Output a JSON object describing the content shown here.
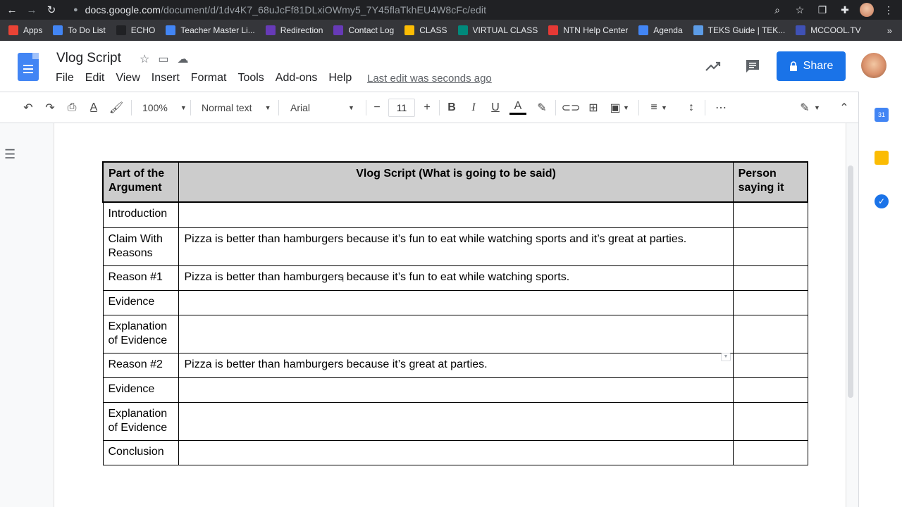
{
  "browser": {
    "url_host": "docs.google.com",
    "url_path": "/document/d/1dv4K7_68uJcFf81DLxiOWmy5_7Y45flaTkhEU4W8cFc/edit"
  },
  "bookmarks": [
    {
      "label": "Apps",
      "color": "#ea4335"
    },
    {
      "label": "To Do List",
      "color": "#4285f4"
    },
    {
      "label": "ECHO",
      "color": "#202124"
    },
    {
      "label": "Teacher Master Li...",
      "color": "#4285f4"
    },
    {
      "label": "Redirection",
      "color": "#673ab7"
    },
    {
      "label": "Contact Log",
      "color": "#673ab7"
    },
    {
      "label": "CLASS",
      "color": "#fbbc04"
    },
    {
      "label": "VIRTUAL CLASS",
      "color": "#00897b"
    },
    {
      "label": "NTN Help Center",
      "color": "#e53935"
    },
    {
      "label": "Agenda",
      "color": "#4285f4"
    },
    {
      "label": "TEKS Guide | TEK...",
      "color": "#5c9ce6"
    },
    {
      "label": "MCCOOL.TV",
      "color": "#3f51b5"
    }
  ],
  "doc": {
    "title": "Vlog Script",
    "last_edit": "Last edit was seconds ago",
    "share_label": "Share"
  },
  "menu": [
    "File",
    "Edit",
    "View",
    "Insert",
    "Format",
    "Tools",
    "Add-ons",
    "Help"
  ],
  "toolbar": {
    "zoom": "100%",
    "style": "Normal text",
    "font": "Arial",
    "font_size": "11"
  },
  "table": {
    "headers": [
      "Part of the Argument",
      "Vlog Script (What is going to be said)",
      "Person saying it"
    ],
    "rows": [
      {
        "part": "Introduction",
        "script": "",
        "person": ""
      },
      {
        "part": "Claim With Reasons",
        "script": "Pizza is better than hamburgers because it’s fun to eat while watching sports and it’s great at parties.",
        "person": ""
      },
      {
        "part": "Reason #1",
        "script": "Pizza is better than hamburgers because it’s fun to eat while watching sports.",
        "person": ""
      },
      {
        "part": "Evidence",
        "script": "",
        "person": ""
      },
      {
        "part": "Explanation of Evidence",
        "script": "",
        "person": ""
      },
      {
        "part": "Reason #2",
        "script": "Pizza is better than hamburgers because it’s great at parties.",
        "person": ""
      },
      {
        "part": "Evidence",
        "script": "",
        "person": ""
      },
      {
        "part": "Explanation of Evidence",
        "script": "",
        "person": ""
      },
      {
        "part": "Conclusion",
        "script": "",
        "person": ""
      }
    ]
  },
  "colors": {
    "accent": "#1a73e8",
    "header_fill": "#cccccc"
  }
}
